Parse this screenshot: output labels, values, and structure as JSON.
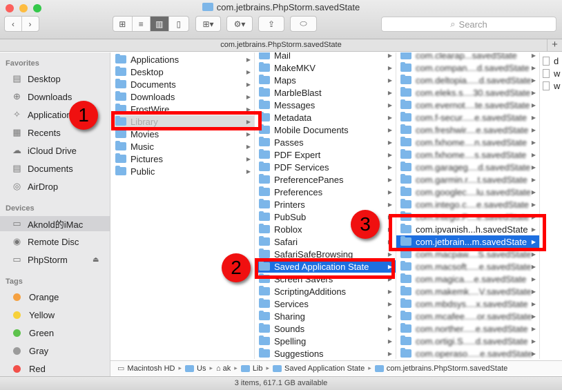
{
  "window": {
    "title": "com.jetbrains.PhpStorm.savedState"
  },
  "toolbar": {
    "search_placeholder": "Search"
  },
  "pathbar": {
    "title": "com.jetbrains.PhpStorm.savedState",
    "plus": "+"
  },
  "sidebar": {
    "favorites_label": "Favorites",
    "favorites": [
      "Desktop",
      "Downloads",
      "Applications",
      "Recents",
      "iCloud Drive",
      "Documents",
      "AirDrop"
    ],
    "devices_label": "Devices",
    "devices": [
      "Aknold的iMac",
      "Remote Disc",
      "PhpStorm"
    ],
    "tags_label": "Tags",
    "tags": [
      {
        "name": "Orange",
        "color": "#f5a142"
      },
      {
        "name": "Yellow",
        "color": "#f7d13a"
      },
      {
        "name": "Green",
        "color": "#5dc24c"
      },
      {
        "name": "Gray",
        "color": "#9b9b9b"
      },
      {
        "name": "Red",
        "color": "#f2504a"
      }
    ]
  },
  "column1": [
    "Applications",
    "Desktop",
    "Documents",
    "Downloads",
    "FrostWire",
    "Library",
    "Movies",
    "Music",
    "Pictures",
    "Public"
  ],
  "column2": [
    "Mail",
    "MakeMKV",
    "Maps",
    "MarbleBlast",
    "Messages",
    "Metadata",
    "Mobile Documents",
    "Passes",
    "PDF Expert",
    "PDF Services",
    "PreferencePanes",
    "Preferences",
    "Printers",
    "PubSub",
    "Roblox",
    "Safari",
    "SafariSafeBrowsing",
    "Saved Application State",
    "Screen Savers",
    "ScriptingAdditions",
    "Services",
    "Sharing",
    "Sounds",
    "Spelling",
    "Suggestions"
  ],
  "column3": [
    "com.clearap...savedState",
    "com.compan....d.savedState",
    "com.deltopia.....d.savedState",
    "com.eleks.s....30.savedState",
    "com.evernot....te.savedState",
    "com.f-secur.....e.savedState",
    "com.freshwir....e.savedState",
    "com.fxhome....n.savedState",
    "com.fxhome....s.savedState",
    "com.garageg....d.savedState",
    "com.garmin.r....t.savedState",
    "com.googlec....lu.savedState",
    "com.intego.c....e.savedState",
    "com.intego.P....e.savedState",
    "com.ipvanish...h.savedState",
    "com.jetbrain...m.savedState",
    "com.macpaw....S.savedState",
    "com.macsoft.....e.savedState",
    "com.magica....e.savedState",
    "com.makemk....V.savedState",
    "com.mbdsys....x.savedState",
    "com.mcafee.....or.savedState",
    "com.norther.....e.savedState",
    "com.ortigi.S.....d.savedState",
    "com.operaso.....e.savedState"
  ],
  "column4": [
    "d",
    "w",
    "w"
  ],
  "bottom_path": [
    "Macintosh HD",
    "Us",
    "ak",
    "Lib",
    "Saved Application State",
    "com.jetbrains.PhpStorm.savedState"
  ],
  "status": "3 items, 617.1 GB available",
  "callouts": [
    "1",
    "2",
    "3"
  ]
}
